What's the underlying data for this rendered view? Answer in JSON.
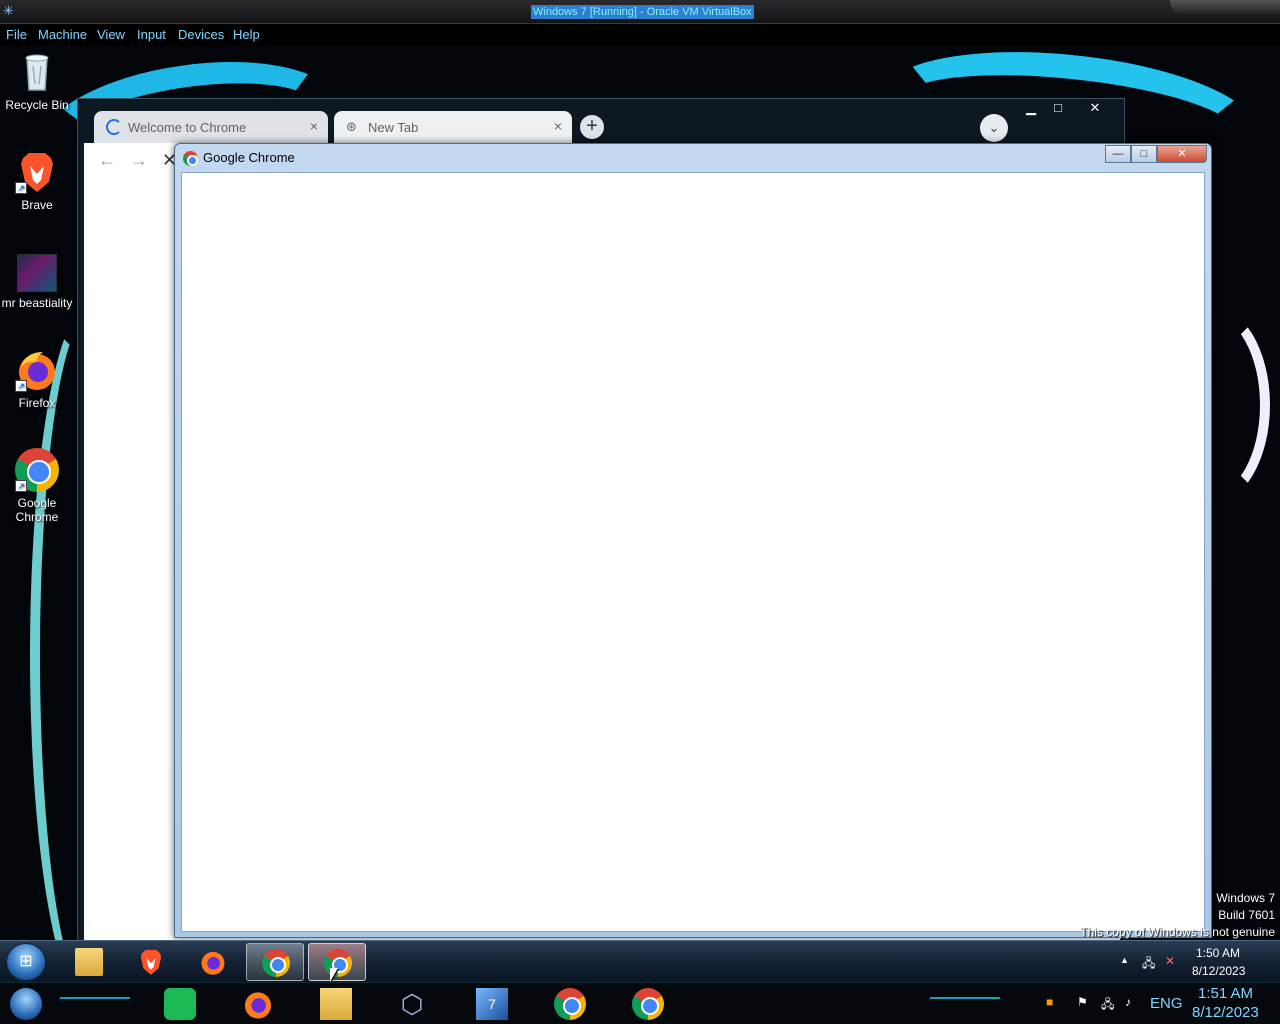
{
  "host_window": {
    "title": "Windows 7 [Running] - Oracle VM VirtualBox",
    "menu": [
      "File",
      "Machine",
      "View",
      "Input",
      "Devices",
      "Help"
    ]
  },
  "desktop_icons": [
    {
      "label": "Recycle Bin",
      "icon": "recycle-bin-icon"
    },
    {
      "label": "Brave",
      "icon": "brave-icon"
    },
    {
      "label": "mr beastiality",
      "icon": "image-file-icon"
    },
    {
      "label": "Firefox",
      "icon": "firefox-icon"
    },
    {
      "label": "Google Chrome",
      "icon": "chrome-icon"
    }
  ],
  "chrome_back": {
    "tabs": [
      {
        "label": "Welcome to Chrome",
        "icon": "loading-spinner-icon",
        "active": false
      },
      {
        "label": "New Tab",
        "icon": "chrome-tab-icon",
        "active": true
      }
    ],
    "close_glyph": "×",
    "new_tab_glyph": "+",
    "tab_search_glyph": "⌄",
    "win_controls": [
      "▁",
      "□",
      "✕"
    ],
    "nav": {
      "back": "←",
      "forward": "→",
      "stop": "✕"
    }
  },
  "chrome_front": {
    "title": "Google Chrome",
    "win_controls": [
      "—",
      "□",
      "✕"
    ]
  },
  "watermark": {
    "line1": "Windows 7",
    "line2": "Build 7601",
    "line3": "This copy of Windows is not genuine"
  },
  "guest_taskbar": {
    "pinned": [
      "explorer-icon",
      "brave-icon",
      "firefox-icon",
      "chrome-icon",
      "chrome-icon"
    ],
    "tray": {
      "time": "1:50 AM",
      "date": "8/12/2023"
    }
  },
  "host_taskbar": {
    "pinned": [
      "start-icon",
      "notes-icon",
      "firefox-icon",
      "explorer-icon",
      "virtualbox-icon",
      "windows7-vm-icon",
      "chrome-icon",
      "chrome-profile-icon"
    ],
    "tray": {
      "language": "ENG",
      "time": "1:51 AM",
      "date": "8/12/2023"
    }
  },
  "colors": {
    "accent": "#1ec6e0",
    "chrome_blue": "#4285f4",
    "win7_frame": "#a9c7e6"
  }
}
